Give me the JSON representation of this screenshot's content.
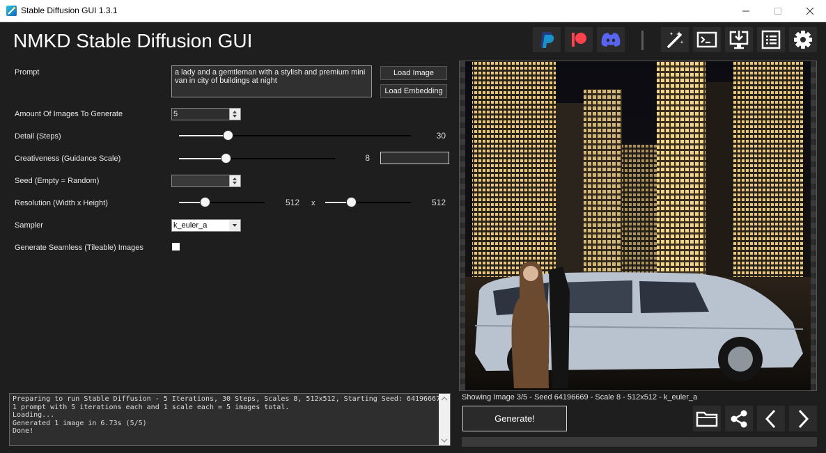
{
  "window": {
    "title": "Stable Diffusion GUI 1.3.1"
  },
  "header": {
    "title": "NMKD Stable Diffusion GUI",
    "icons": [
      "paypal-icon",
      "patreon-icon",
      "discord-icon",
      "magic-wand-icon",
      "terminal-icon",
      "install-icon",
      "list-icon",
      "gear-icon"
    ]
  },
  "form": {
    "prompt": {
      "label": "Prompt",
      "value": "a lady and a gemtleman with a stylish and premium mini van in city of buildings at night"
    },
    "load_image_label": "Load Image",
    "load_embedding_label": "Load Embedding",
    "images": {
      "label": "Amount Of Images To Generate",
      "value": "5"
    },
    "steps": {
      "label": "Detail (Steps)",
      "value": "30",
      "fraction": 0.21
    },
    "scale": {
      "label": "Creativeness (Guidance Scale)",
      "value": "8",
      "fraction": 0.3,
      "extra_field": ""
    },
    "seed": {
      "label": "Seed (Empty = Random)",
      "value": ""
    },
    "resolution": {
      "label": "Resolution (Width x Height)",
      "width": "512",
      "height": "512",
      "separator": "x",
      "width_fraction": 0.3,
      "height_fraction": 0.3
    },
    "sampler": {
      "label": "Sampler",
      "value": "k_euler_a"
    },
    "seamless": {
      "label": "Generate Seamless (Tileable) Images",
      "checked": false
    }
  },
  "log": {
    "lines": [
      "Preparing to run Stable Diffusion - 5 Iterations, 30 Steps, Scales 8, 512x512, Starting Seed: 64196667",
      "1 prompt with 5 iterations each and 1 scale each = 5 images total.",
      "Loading...",
      "Generated 1 image in 6.73s (5/5)",
      "Done!"
    ]
  },
  "preview": {
    "info": "Showing Image 3/5  - Seed 64196669 - Scale 8 - 512x512 - k_euler_a",
    "generate_label": "Generate!",
    "nav_icons": [
      "folder-icon",
      "share-icon",
      "previous-icon",
      "next-icon"
    ],
    "progress": 0
  },
  "colors": {
    "background": "#1e1e1e",
    "panel": "#2b2b2b",
    "paypal_blue": "#253b80",
    "patreon_red": "#ff424d",
    "discord": "#5865f2"
  }
}
